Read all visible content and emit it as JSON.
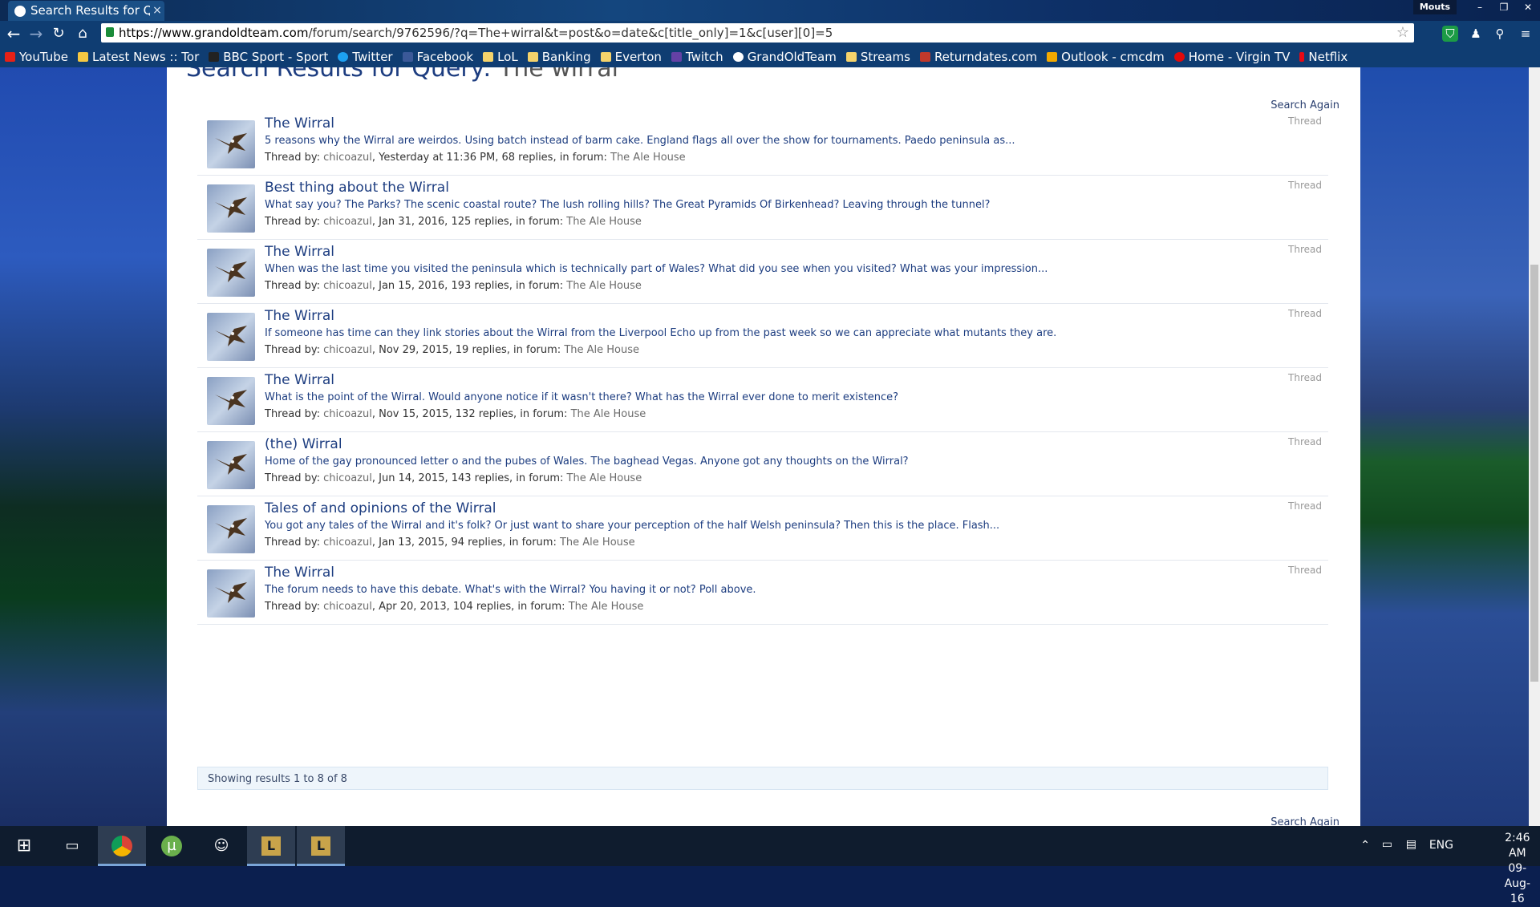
{
  "browser": {
    "tab_title": "Search Results for Q",
    "tab_close": "×",
    "profile": "Mouts",
    "url_host": "https://www.grandoldteam.com",
    "url_path": "/forum/search/9762596/?q=The+wirral&t=post&o=date&c[title_only]=1&c[user][0]=5",
    "window_controls": [
      "–",
      "❐",
      "✕"
    ]
  },
  "bookmarks": [
    {
      "label": "YouTube",
      "color": "#e62117"
    },
    {
      "label": "Latest News :: Tor",
      "color": "#f5c842"
    },
    {
      "label": "BBC Sport - Sport",
      "color": "#222222"
    },
    {
      "label": "Twitter",
      "color": "#1da1f2"
    },
    {
      "label": "Facebook",
      "color": "#3b5998"
    },
    {
      "label": "LoL",
      "color": "#f5d36b"
    },
    {
      "label": "Banking",
      "color": "#f5d36b"
    },
    {
      "label": "Everton",
      "color": "#f5d36b"
    },
    {
      "label": "Twitch",
      "color": "#6441a5"
    },
    {
      "label": "GrandOldTeam",
      "color": "#ffffff"
    },
    {
      "label": "Streams",
      "color": "#f5d36b"
    },
    {
      "label": "Returndates.com",
      "color": "#c0392b"
    },
    {
      "label": "Outlook - cmcdm",
      "color": "#f2a900"
    },
    {
      "label": "Home - Virgin TV",
      "color": "#e10a0a"
    },
    {
      "label": "Netflix",
      "color": "#e50914"
    }
  ],
  "page": {
    "title_prefix": "Search Results for Query: ",
    "title_query": "The wirral",
    "search_again": "Search Again",
    "showing": "Showing results 1 to 8 of 8"
  },
  "results": [
    {
      "title": "The Wirral",
      "snippet": "5 reasons why the Wirral are weirdos. Using batch instead of barm cake. England flags all over the show for tournaments. Paedo peninsula as...",
      "by_label": "Thread by: ",
      "author": "chicoazul",
      "details": ", Yesterday at 11:36 PM, 68 replies, in forum: ",
      "forum": "The Ale House",
      "type": "Thread"
    },
    {
      "title": "Best thing about the Wirral",
      "snippet": "What say you? The Parks? The scenic coastal route? The lush rolling hills? The Great Pyramids Of Birkenhead? Leaving through the tunnel?",
      "by_label": "Thread by: ",
      "author": "chicoazul",
      "details": ", Jan 31, 2016, 125 replies, in forum: ",
      "forum": "The Ale House",
      "type": "Thread"
    },
    {
      "title": "The Wirral",
      "snippet": "When was the last time you visited the peninsula which is technically part of Wales? What did you see when you visited? What was your impression...",
      "by_label": "Thread by: ",
      "author": "chicoazul",
      "details": ", Jan 15, 2016, 193 replies, in forum: ",
      "forum": "The Ale House",
      "type": "Thread"
    },
    {
      "title": "The Wirral",
      "snippet": "If someone has time can they link stories about the Wirral from the Liverpool Echo up from the past week so we can appreciate what mutants they are.",
      "by_label": "Thread by: ",
      "author": "chicoazul",
      "details": ", Nov 29, 2015, 19 replies, in forum: ",
      "forum": "The Ale House",
      "type": "Thread"
    },
    {
      "title": "The Wirral",
      "snippet": "What is the point of the Wirral. Would anyone notice if it wasn't there? What has the Wirral ever done to merit existence?",
      "by_label": "Thread by: ",
      "author": "chicoazul",
      "details": ", Nov 15, 2015, 132 replies, in forum: ",
      "forum": "The Ale House",
      "type": "Thread"
    },
    {
      "title": "(the) Wirral",
      "snippet": "Home of the gay pronounced letter o and the pubes of Wales. The baghead Vegas. Anyone got any thoughts on the Wirral?",
      "by_label": "Thread by: ",
      "author": "chicoazul",
      "details": ", Jun 14, 2015, 143 replies, in forum: ",
      "forum": "The Ale House",
      "type": "Thread"
    },
    {
      "title": "Tales of and opinions of the Wirral",
      "snippet": "You got any tales of the Wirral and it's folk? Or just want to share your perception of the half Welsh peninsula? Then this is the place. Flash...",
      "by_label": "Thread by: ",
      "author": "chicoazul",
      "details": ", Jan 13, 2015, 94 replies, in forum: ",
      "forum": "The Ale House",
      "type": "Thread"
    },
    {
      "title": "The Wirral",
      "snippet": "The forum needs to have this debate. What's with the Wirral? You having it or not? Poll above.",
      "by_label": "Thread by: ",
      "author": "chicoazul",
      "details": ", Apr 20, 2013, 104 replies, in forum: ",
      "forum": "The Ale House",
      "type": "Thread"
    }
  ],
  "taskbar": {
    "apps": [
      "start-icon",
      "task-view-icon",
      "chrome-icon",
      "utorrent-icon",
      "discord-icon",
      "league-icon",
      "league-icon-2"
    ],
    "lang": "ENG",
    "time": "2:46 AM",
    "date": "09-Aug-16"
  }
}
